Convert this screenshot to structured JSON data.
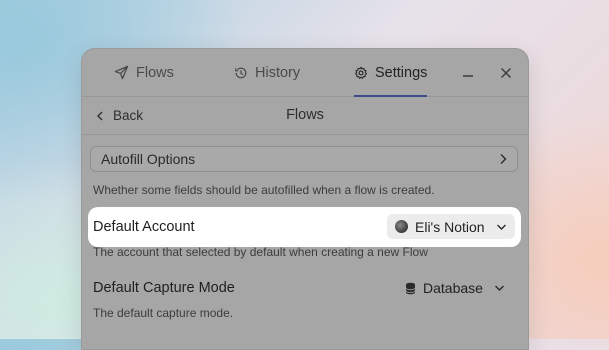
{
  "tabs": [
    {
      "label": "Flows",
      "icon": "send-icon"
    },
    {
      "label": "History",
      "icon": "history-icon"
    },
    {
      "label": "Settings",
      "icon": "gear-icon",
      "active": true
    }
  ],
  "window_controls": {
    "minimize": "minimize-icon",
    "close": "close-icon"
  },
  "subheader": {
    "back_label": "Back",
    "title": "Flows"
  },
  "autofill": {
    "label": "Autofill Options",
    "description": "Whether some fields should be autofilled when a flow is created."
  },
  "default_account": {
    "label": "Default Account",
    "value": "Eli's Notion",
    "description": "The account that selected by default when creating a new Flow"
  },
  "capture_mode": {
    "label": "Default Capture Mode",
    "value": "Database",
    "description": "The default capture mode."
  },
  "colors": {
    "highlight": "#ffffff",
    "overlay": "#a6a6a6",
    "active_tab_underline": "#3a4a8a"
  }
}
